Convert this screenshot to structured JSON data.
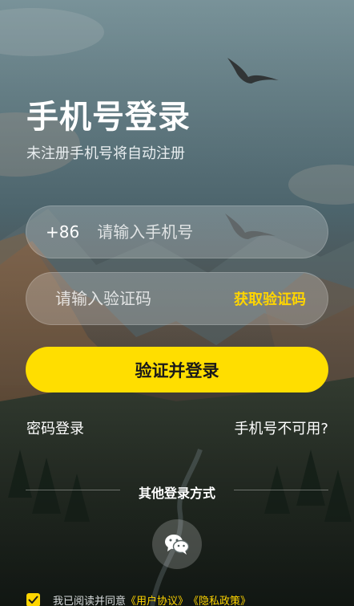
{
  "header": {
    "title": "手机号登录",
    "subtitle": "未注册手机号将自动注册"
  },
  "phone_field": {
    "country_code": "+86",
    "placeholder": "请输入手机号",
    "value": ""
  },
  "code_field": {
    "placeholder": "请输入验证码",
    "value": "",
    "get_code_label": "获取验证码"
  },
  "login_button": {
    "label": "验证并登录"
  },
  "links": {
    "password_login": "密码登录",
    "phone_unavailable": "手机号不可用?"
  },
  "other_login": {
    "divider_text": "其他登录方式",
    "options": [
      {
        "icon": "wechat-icon"
      }
    ]
  },
  "agreement": {
    "checked": true,
    "prefix": "我已阅读并同意",
    "user_agreement": "《用户协议》",
    "privacy_policy": "《隐私政策》"
  },
  "colors": {
    "accent": "#ffde00",
    "link_accent": "#ffd500"
  }
}
